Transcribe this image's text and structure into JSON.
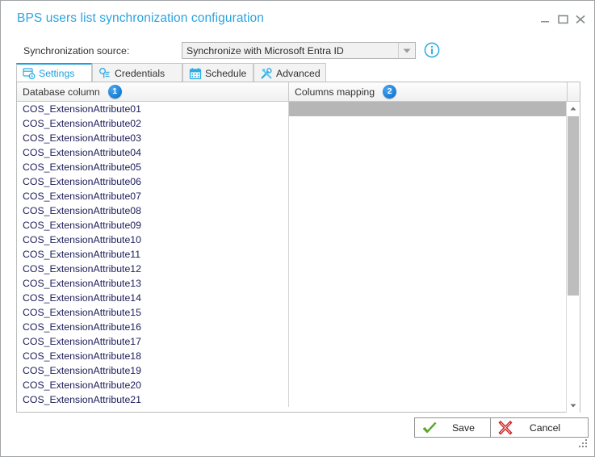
{
  "window": {
    "title": "BPS users list synchronization configuration",
    "controls": {
      "minimize": "minimize-icon",
      "maximize": "maximize-icon",
      "close": "close-icon"
    },
    "accent_color": "#1a9fe0",
    "title_color": "#2aa3e0"
  },
  "sync_source": {
    "label": "Synchronization source:",
    "selected": "Synchronize with Microsoft Entra ID",
    "options": [
      "Synchronize with Microsoft Entra ID"
    ],
    "dropdown_icon": "chevron-down-icon",
    "info_icon": "info-icon"
  },
  "tabs": [
    {
      "id": "settings",
      "label": "Settings",
      "icon": "database-settings-icon",
      "active": true
    },
    {
      "id": "credentials",
      "label": "Credentials",
      "icon": "key-icon",
      "active": false
    },
    {
      "id": "schedule",
      "label": "Schedule",
      "icon": "calendar-icon",
      "active": false
    },
    {
      "id": "advanced",
      "label": "Advanced",
      "icon": "tools-icon",
      "active": false
    }
  ],
  "grid": {
    "columns": [
      {
        "header": "Database column",
        "badge": "1"
      },
      {
        "header": "Columns mapping",
        "badge": "2"
      }
    ],
    "selected_row_index": 0,
    "rows": [
      {
        "database_column": "COS_ExtensionAttribute01",
        "columns_mapping": ""
      },
      {
        "database_column": "COS_ExtensionAttribute02",
        "columns_mapping": ""
      },
      {
        "database_column": "COS_ExtensionAttribute03",
        "columns_mapping": ""
      },
      {
        "database_column": "COS_ExtensionAttribute04",
        "columns_mapping": ""
      },
      {
        "database_column": "COS_ExtensionAttribute05",
        "columns_mapping": ""
      },
      {
        "database_column": "COS_ExtensionAttribute06",
        "columns_mapping": ""
      },
      {
        "database_column": "COS_ExtensionAttribute07",
        "columns_mapping": ""
      },
      {
        "database_column": "COS_ExtensionAttribute08",
        "columns_mapping": ""
      },
      {
        "database_column": "COS_ExtensionAttribute09",
        "columns_mapping": ""
      },
      {
        "database_column": "COS_ExtensionAttribute10",
        "columns_mapping": ""
      },
      {
        "database_column": "COS_ExtensionAttribute11",
        "columns_mapping": ""
      },
      {
        "database_column": "COS_ExtensionAttribute12",
        "columns_mapping": ""
      },
      {
        "database_column": "COS_ExtensionAttribute13",
        "columns_mapping": ""
      },
      {
        "database_column": "COS_ExtensionAttribute14",
        "columns_mapping": ""
      },
      {
        "database_column": "COS_ExtensionAttribute15",
        "columns_mapping": ""
      },
      {
        "database_column": "COS_ExtensionAttribute16",
        "columns_mapping": ""
      },
      {
        "database_column": "COS_ExtensionAttribute17",
        "columns_mapping": ""
      },
      {
        "database_column": "COS_ExtensionAttribute18",
        "columns_mapping": ""
      },
      {
        "database_column": "COS_ExtensionAttribute19",
        "columns_mapping": ""
      },
      {
        "database_column": "COS_ExtensionAttribute20",
        "columns_mapping": ""
      },
      {
        "database_column": "COS_ExtensionAttribute21",
        "columns_mapping": ""
      }
    ]
  },
  "scrollbar": {
    "up_icon": "scroll-up-icon",
    "down_icon": "scroll-down-icon"
  },
  "footer": {
    "save_label": "Save",
    "save_icon": "green-check-icon",
    "cancel_label": "Cancel",
    "cancel_icon": "red-x-icon",
    "resize_grip": "resize-grip-icon"
  }
}
